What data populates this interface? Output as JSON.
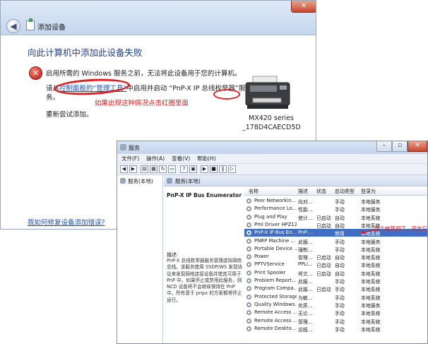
{
  "wizard": {
    "title": "添加设备",
    "close_glyph": "✕",
    "back_glyph": "◀",
    "heading": "向此计算机中添加此设备失败",
    "error_message": "启用所需的 Windows 服务之前，无法将此设备用于您的计算机。",
    "line2_prefix": "请从",
    "line2_link": "控制面板的“管理工具”",
    "line2_suffix": "中启用并启动 “PnP-X IP 总线枚举器”服务。",
    "annotation": "如果出现这种情况点击红圈里面",
    "retry": "重新尝试添加。",
    "device_name": "MX420 series",
    "device_id": "_178D4CAECD5D",
    "help_link": "我如何修复设备添加错误?"
  },
  "services": {
    "title": "服务",
    "controls": {
      "min": "–",
      "max": "▫",
      "close": "✕"
    },
    "menu": [
      "文件(F)",
      "操作(A)",
      "查看(V)",
      "帮助(H)"
    ],
    "tree_item": "服务(本地)",
    "panel_title": "服务(本地)",
    "selected_name": "PnP-X IP Bus Enumerator",
    "desc_label": "描述:",
    "desc_body": "PnP-X 总线枚举器服务管理虚拟网络总线。该服务使用 SSDP/WS 发现协议来发现网络连接设备并使其可用于 PnP 中。如果停止或禁用此服务，则 NCD 设备将不会继续保持在 PnP 中。所有基于 pnpx 的方案都将停止运行。",
    "columns": [
      "名称",
      "描述",
      "状态",
      "启动类型",
      "登录为"
    ],
    "rows": [
      {
        "name": "Peer Networkin...",
        "desc": "向对...",
        "status": "",
        "startup": "手动",
        "logon": "本地服务",
        "selected": false
      },
      {
        "name": "Performance Lo...",
        "desc": "性能...",
        "status": "",
        "startup": "手动",
        "logon": "本地服务",
        "selected": false
      },
      {
        "name": "Plug and Play",
        "desc": "使计...",
        "status": "已启动",
        "startup": "自动",
        "logon": "本地系统",
        "selected": false
      },
      {
        "name": "Pml Driver HPZ12",
        "desc": "",
        "status": "已启动",
        "startup": "自动",
        "logon": "本地系统",
        "selected": false
      },
      {
        "name": "PnP-X IP Bus En...",
        "desc": "PnP-...",
        "status": "",
        "startup": "禁用",
        "logon": "本地系统",
        "selected": true
      },
      {
        "name": "PNRP Machine ...",
        "desc": "此服...",
        "status": "",
        "startup": "手动",
        "logon": "本地服务",
        "selected": false
      },
      {
        "name": "Portable Device ...",
        "desc": "强制...",
        "status": "",
        "startup": "手动",
        "logon": "本地系统",
        "selected": false
      },
      {
        "name": "Power",
        "desc": "管理...",
        "status": "已启动",
        "startup": "自动",
        "logon": "本地系统",
        "selected": false
      },
      {
        "name": "PPTVService",
        "desc": "PPLi...",
        "status": "已启动",
        "startup": "自动",
        "logon": "本地系统",
        "selected": false
      },
      {
        "name": "Print Spooler",
        "desc": "将文...",
        "status": "已启动",
        "startup": "自动",
        "logon": "本地系统",
        "selected": false
      },
      {
        "name": "Problem Report...",
        "desc": "此服...",
        "status": "",
        "startup": "手动",
        "logon": "本地系统",
        "selected": false
      },
      {
        "name": "Program Compa...",
        "desc": "此服...",
        "status": "已启动",
        "startup": "手动",
        "logon": "本地系统",
        "selected": false
      },
      {
        "name": "Protected Storage",
        "desc": "为敏...",
        "status": "",
        "startup": "手动",
        "logon": "本地系统",
        "selected": false
      },
      {
        "name": "Quality Windows...",
        "desc": "优质...",
        "status": "",
        "startup": "手动",
        "logon": "本地服务",
        "selected": false
      },
      {
        "name": "Remote Access ...",
        "desc": "无论...",
        "status": "",
        "startup": "手动",
        "logon": "本地系统",
        "selected": false
      },
      {
        "name": "Remote Access ...",
        "desc": "管理...",
        "status": "",
        "startup": "手动",
        "logon": "本地系统",
        "selected": false
      },
      {
        "name": "Remote Deskto...",
        "desc": "远程...",
        "status": "",
        "startup": "手动",
        "logon": "本地系统",
        "selected": false
      }
    ],
    "annotation": "这个被禁用了，双击它"
  }
}
